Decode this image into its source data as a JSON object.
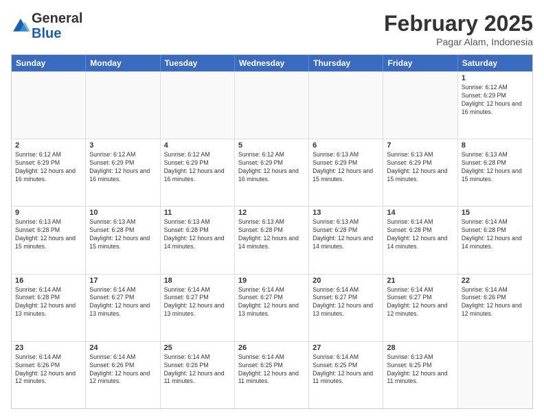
{
  "logo": {
    "line1": "General",
    "line2": "Blue"
  },
  "header": {
    "month": "February 2025",
    "location": "Pagar Alam, Indonesia"
  },
  "weekdays": [
    "Sunday",
    "Monday",
    "Tuesday",
    "Wednesday",
    "Thursday",
    "Friday",
    "Saturday"
  ],
  "rows": [
    [
      {
        "day": "",
        "text": ""
      },
      {
        "day": "",
        "text": ""
      },
      {
        "day": "",
        "text": ""
      },
      {
        "day": "",
        "text": ""
      },
      {
        "day": "",
        "text": ""
      },
      {
        "day": "",
        "text": ""
      },
      {
        "day": "1",
        "text": "Sunrise: 6:12 AM\nSunset: 6:29 PM\nDaylight: 12 hours and 16 minutes."
      }
    ],
    [
      {
        "day": "2",
        "text": "Sunrise: 6:12 AM\nSunset: 6:29 PM\nDaylight: 12 hours and 16 minutes."
      },
      {
        "day": "3",
        "text": "Sunrise: 6:12 AM\nSunset: 6:29 PM\nDaylight: 12 hours and 16 minutes."
      },
      {
        "day": "4",
        "text": "Sunrise: 6:12 AM\nSunset: 6:29 PM\nDaylight: 12 hours and 16 minutes."
      },
      {
        "day": "5",
        "text": "Sunrise: 6:12 AM\nSunset: 6:29 PM\nDaylight: 12 hours and 16 minutes."
      },
      {
        "day": "6",
        "text": "Sunrise: 6:13 AM\nSunset: 6:29 PM\nDaylight: 12 hours and 15 minutes."
      },
      {
        "day": "7",
        "text": "Sunrise: 6:13 AM\nSunset: 6:29 PM\nDaylight: 12 hours and 15 minutes."
      },
      {
        "day": "8",
        "text": "Sunrise: 6:13 AM\nSunset: 6:28 PM\nDaylight: 12 hours and 15 minutes."
      }
    ],
    [
      {
        "day": "9",
        "text": "Sunrise: 6:13 AM\nSunset: 6:28 PM\nDaylight: 12 hours and 15 minutes."
      },
      {
        "day": "10",
        "text": "Sunrise: 6:13 AM\nSunset: 6:28 PM\nDaylight: 12 hours and 15 minutes."
      },
      {
        "day": "11",
        "text": "Sunrise: 6:13 AM\nSunset: 6:28 PM\nDaylight: 12 hours and 14 minutes."
      },
      {
        "day": "12",
        "text": "Sunrise: 6:13 AM\nSunset: 6:28 PM\nDaylight: 12 hours and 14 minutes."
      },
      {
        "day": "13",
        "text": "Sunrise: 6:13 AM\nSunset: 6:28 PM\nDaylight: 12 hours and 14 minutes."
      },
      {
        "day": "14",
        "text": "Sunrise: 6:14 AM\nSunset: 6:28 PM\nDaylight: 12 hours and 14 minutes."
      },
      {
        "day": "15",
        "text": "Sunrise: 6:14 AM\nSunset: 6:28 PM\nDaylight: 12 hours and 14 minutes."
      }
    ],
    [
      {
        "day": "16",
        "text": "Sunrise: 6:14 AM\nSunset: 6:28 PM\nDaylight: 12 hours and 13 minutes."
      },
      {
        "day": "17",
        "text": "Sunrise: 6:14 AM\nSunset: 6:27 PM\nDaylight: 12 hours and 13 minutes."
      },
      {
        "day": "18",
        "text": "Sunrise: 6:14 AM\nSunset: 6:27 PM\nDaylight: 12 hours and 13 minutes."
      },
      {
        "day": "19",
        "text": "Sunrise: 6:14 AM\nSunset: 6:27 PM\nDaylight: 12 hours and 13 minutes."
      },
      {
        "day": "20",
        "text": "Sunrise: 6:14 AM\nSunset: 6:27 PM\nDaylight: 12 hours and 13 minutes."
      },
      {
        "day": "21",
        "text": "Sunrise: 6:14 AM\nSunset: 6:27 PM\nDaylight: 12 hours and 12 minutes."
      },
      {
        "day": "22",
        "text": "Sunrise: 6:14 AM\nSunset: 6:26 PM\nDaylight: 12 hours and 12 minutes."
      }
    ],
    [
      {
        "day": "23",
        "text": "Sunrise: 6:14 AM\nSunset: 6:26 PM\nDaylight: 12 hours and 12 minutes."
      },
      {
        "day": "24",
        "text": "Sunrise: 6:14 AM\nSunset: 6:26 PM\nDaylight: 12 hours and 12 minutes."
      },
      {
        "day": "25",
        "text": "Sunrise: 6:14 AM\nSunset: 6:26 PM\nDaylight: 12 hours and 11 minutes."
      },
      {
        "day": "26",
        "text": "Sunrise: 6:14 AM\nSunset: 6:25 PM\nDaylight: 12 hours and 11 minutes."
      },
      {
        "day": "27",
        "text": "Sunrise: 6:14 AM\nSunset: 6:25 PM\nDaylight: 12 hours and 11 minutes."
      },
      {
        "day": "28",
        "text": "Sunrise: 6:13 AM\nSunset: 6:25 PM\nDaylight: 12 hours and 11 minutes."
      },
      {
        "day": "",
        "text": ""
      }
    ]
  ]
}
